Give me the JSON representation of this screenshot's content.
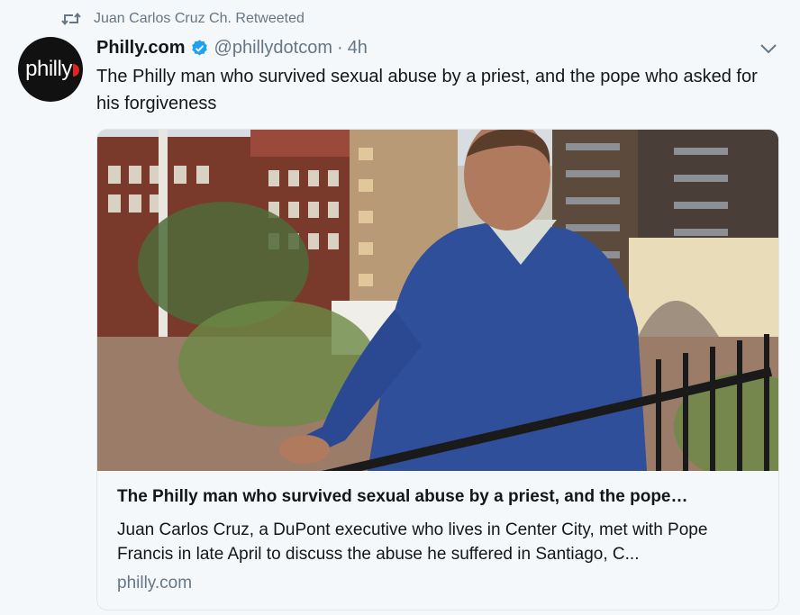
{
  "retweet": {
    "icon": "retweet-icon",
    "text": "Juan Carlos Cruz Ch. Retweeted"
  },
  "tweet": {
    "avatar_text": "philly",
    "author_name": "Philly.com",
    "verified_icon": "verified-badge-icon",
    "handle": "@phillydotcom",
    "separator": "·",
    "timestamp": "4h",
    "caret_icon": "chevron-down-icon",
    "text": "The Philly man who survived sexual abuse by a priest, and the pope who asked for his forgiveness"
  },
  "card": {
    "image_icon": "article-photo",
    "title": "The Philly man who survived sexual abuse by a priest, and the pope…",
    "description": "Juan Carlos Cruz, a DuPont executive who lives in Center City, met with Pope Francis in late April to discuss the abuse he suffered in Santiago, C...",
    "domain": "philly.com"
  },
  "colors": {
    "background": "#f5f8fa",
    "secondary_text": "#657786",
    "primary_text": "#14171a",
    "verified_blue": "#1da1f2",
    "card_border": "#e1e8ed"
  }
}
